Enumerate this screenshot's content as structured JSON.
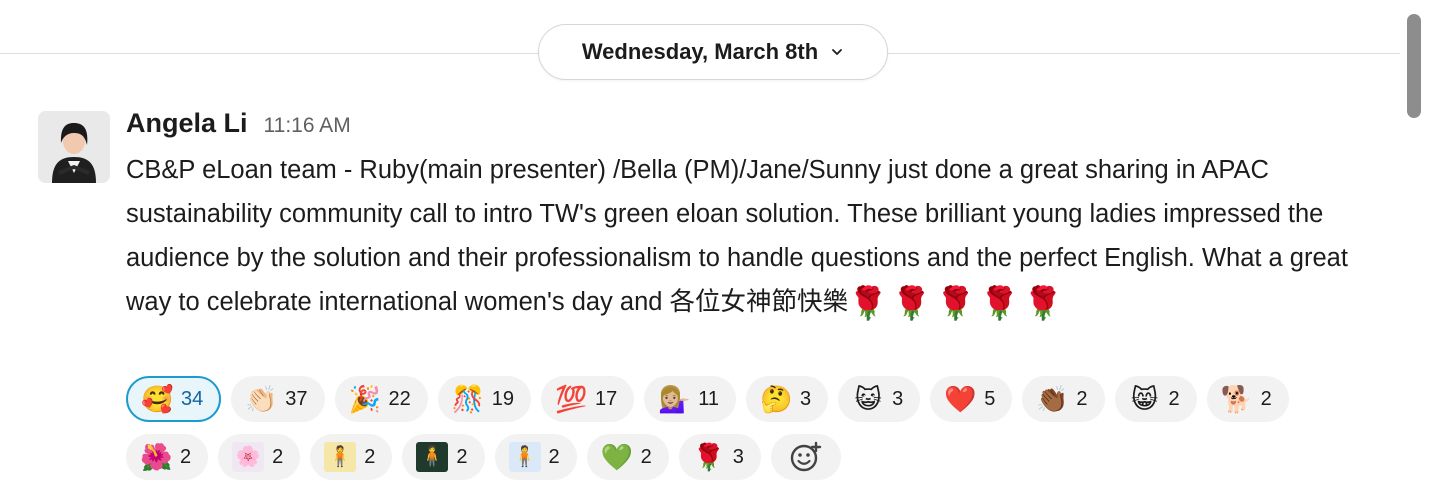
{
  "date_divider": {
    "label": "Wednesday, March 8th",
    "chevron_icon": "chevron-down-icon"
  },
  "message": {
    "author": "Angela Li",
    "time": "11:16 AM",
    "avatar_icon": "user-avatar",
    "text": "CB&P eLoan team - Ruby(main presenter) /Bella (PM)/Jane/Sunny just done a great sharing in APAC sustainability community call to intro TW's green eloan solution.  These brilliant young ladies impressed the audience by the solution and their professionalism to handle questions and the perfect English. What a great way to celebrate international women's day and 各位女神節快樂",
    "roses": "🌹🌹🌹🌹🌹"
  },
  "reactions": [
    {
      "emoji": "🥰",
      "count": "34",
      "active": true
    },
    {
      "emoji": "👏🏻",
      "count": "37"
    },
    {
      "emoji": "🎉",
      "count": "22"
    },
    {
      "emoji": "🎊",
      "count": "19"
    },
    {
      "emoji": "💯",
      "count": "17"
    },
    {
      "emoji": "💁🏼‍♀️",
      "count": "11"
    },
    {
      "emoji": "🤔",
      "count": "3"
    },
    {
      "emoji": "😺",
      "count": "3"
    },
    {
      "emoji": "❤️",
      "count": "5"
    },
    {
      "emoji": "👏🏾",
      "count": "2"
    },
    {
      "emoji": "😸",
      "count": "2"
    },
    {
      "emoji": "🐕",
      "count": "2"
    },
    {
      "emoji": "🌺",
      "count": "2"
    },
    {
      "emoji": "🌸",
      "count": "2"
    },
    {
      "emoji": "🧍",
      "count": "2"
    },
    {
      "emoji": "🧍",
      "count": "2"
    },
    {
      "emoji": "🧍",
      "count": "2"
    },
    {
      "emoji": "💚",
      "count": "2"
    },
    {
      "emoji": "🌹",
      "count": "3"
    }
  ],
  "add_reaction_icon": "add-reaction-icon",
  "colors": {
    "accent": "#1d9bd1",
    "active_bg": "#e8f5fa",
    "pill_bg": "#f2f2f2"
  }
}
